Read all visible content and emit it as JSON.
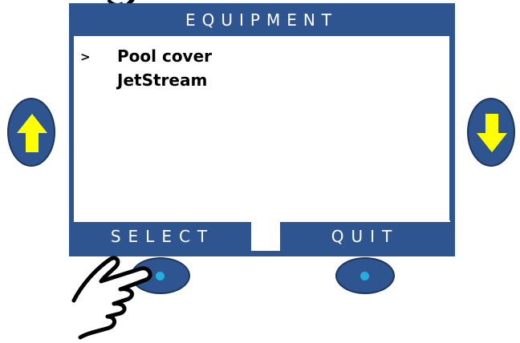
{
  "screen": {
    "title": "EQUIPMENT",
    "cursor": ">",
    "items": [
      {
        "label": "Pool cover",
        "selected": true
      },
      {
        "label": "JetStream",
        "selected": false
      }
    ]
  },
  "softkeys": {
    "left": "SELECT",
    "right": "QUIT"
  },
  "buttons": {
    "up_icon": "arrow-up-icon",
    "down_icon": "arrow-down-icon"
  },
  "colors": {
    "panel": "#2f5590",
    "arrow": "#ffff00",
    "dot": "#21b0e0"
  }
}
